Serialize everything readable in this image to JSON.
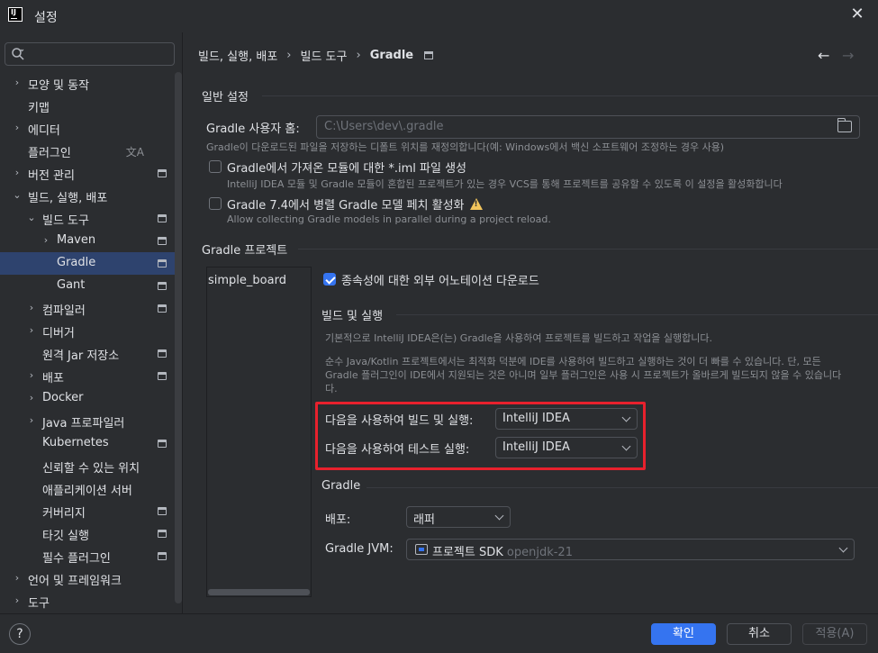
{
  "window": {
    "title": "설정",
    "app_icon": "IJ"
  },
  "search": {
    "placeholder": ""
  },
  "sidebar": {
    "items": [
      {
        "label": "모양 및 동작",
        "expandable": true,
        "indent": 0
      },
      {
        "label": "키맵",
        "expandable": false,
        "indent": 0
      },
      {
        "label": "에디터",
        "expandable": true,
        "indent": 0
      },
      {
        "label": "플러그인",
        "expandable": false,
        "indent": 0,
        "lang_icon": "文A"
      },
      {
        "label": "버전 관리",
        "expandable": true,
        "indent": 0,
        "project_icon": true
      },
      {
        "label": "빌드, 실행, 배포",
        "expandable": true,
        "expanded": true,
        "indent": 0
      },
      {
        "label": "빌드 도구",
        "expandable": true,
        "expanded": true,
        "indent": 1,
        "project_icon": true
      },
      {
        "label": "Maven",
        "expandable": true,
        "indent": 2,
        "project_icon": true
      },
      {
        "label": "Gradle",
        "expandable": false,
        "indent": 2,
        "project_icon": true,
        "selected": true
      },
      {
        "label": "Gant",
        "expandable": false,
        "indent": 2,
        "project_icon": true
      },
      {
        "label": "컴파일러",
        "expandable": true,
        "indent": 1,
        "project_icon": true
      },
      {
        "label": "디버거",
        "expandable": true,
        "indent": 1
      },
      {
        "label": "원격 Jar 저장소",
        "expandable": false,
        "indent": 1,
        "project_icon": true
      },
      {
        "label": "배포",
        "expandable": true,
        "indent": 1,
        "project_icon": true
      },
      {
        "label": "Docker",
        "expandable": true,
        "indent": 1
      },
      {
        "label": "Java 프로파일러",
        "expandable": true,
        "indent": 1
      },
      {
        "label": "Kubernetes",
        "expandable": false,
        "indent": 1,
        "project_icon": true
      },
      {
        "label": "신뢰할 수 있는 위치",
        "expandable": false,
        "indent": 1
      },
      {
        "label": "애플리케이션 서버",
        "expandable": false,
        "indent": 1
      },
      {
        "label": "커버리지",
        "expandable": false,
        "indent": 1,
        "project_icon": true
      },
      {
        "label": "타깃 실행",
        "expandable": false,
        "indent": 1,
        "project_icon": true
      },
      {
        "label": "필수 플러그인",
        "expandable": false,
        "indent": 1,
        "project_icon": true
      },
      {
        "label": "언어 및 프레임워크",
        "expandable": true,
        "indent": 0
      },
      {
        "label": "도구",
        "expandable": true,
        "indent": 0
      }
    ]
  },
  "breadcrumb": {
    "part1": "빌드, 실행, 배포",
    "part2": "빌드 도구",
    "part3": "Gradle"
  },
  "general": {
    "title": "일반 설정",
    "home_label": "Gradle 사용자 홈:",
    "home_value": "C:\\Users\\dev\\.gradle",
    "home_hint": "Gradle이 다운로드된 파일을 저장하는 디폴트 위치를 재정의합니다(예: Windows에서 백신 소프트웨어 조정하는 경우 사용)",
    "iml_label": "Gradle에서 가져온 모듈에 대한 *.iml 파일 생성",
    "iml_hint": "IntelliJ IDEA 모듈 및 Gradle 모듈이 혼합된 프로젝트가 있는 경우 VCS를 통해 프로젝트를 공유할 수 있도록 이 설정을 활성화합니다",
    "parallel_label": "Gradle 7.4에서 병렬 Gradle 모델 페치 활성화",
    "parallel_hint": "Allow collecting Gradle models in parallel during a project reload."
  },
  "projects": {
    "title": "Gradle 프로젝트",
    "items": [
      "simple_board"
    ],
    "download_annotations_label": "종속성에 대한 외부 어노테이션 다운로드"
  },
  "build_run": {
    "title": "빌드 및 실행",
    "desc1": "기본적으로 IntelliJ IDEA은(는) Gradle을 사용하여 프로젝트를 빌드하고 작업을 실행합니다.",
    "desc2a": "순수 Java/Kotlin 프로젝트에서는 최적화 덕분에 IDE를 사용하여 빌드하고 실행하는 것이 더 빠를 수 있습니다. 단, 모든",
    "desc2b": "Gradle 플러그인이 IDE에서 지원되는 것은 아니며 일부 플러그인은 사용 시 프로젝트가 올바르게 빌드되지 않을 수 있습니다",
    "desc2c": "다.",
    "build_label": "다음을 사용하여 빌드 및 실행:",
    "build_value": "IntelliJ IDEA",
    "test_label": "다음을 사용하여 테스트 실행:",
    "test_value": "IntelliJ IDEA"
  },
  "gradle": {
    "title": "Gradle",
    "dist_label": "배포:",
    "dist_value": "래퍼",
    "jvm_label": "Gradle JVM:",
    "jvm_value": "프로젝트 SDK",
    "jvm_detail": "openjdk-21"
  },
  "buttons": {
    "ok": "확인",
    "cancel": "취소",
    "apply": "적용(A)",
    "help": "?"
  },
  "colors": {
    "accent": "#3574f0",
    "highlight": "#e8212d",
    "background": "#2b2d30",
    "selection": "#2e436e"
  }
}
